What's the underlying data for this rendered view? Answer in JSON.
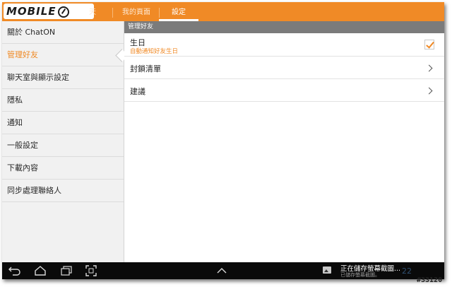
{
  "logo": {
    "text": "MOBILE",
    "name": "mobile01-logo"
  },
  "tabs": [
    {
      "label": "天",
      "active": false
    },
    {
      "label": "我的頁面",
      "active": false
    },
    {
      "label": "設定",
      "active": true
    }
  ],
  "sidebar": {
    "items": [
      {
        "label": "關於 ChatON",
        "active": false
      },
      {
        "label": "管理好友",
        "active": true
      },
      {
        "label": "聊天室與顯示設定",
        "active": false
      },
      {
        "label": "隱私",
        "active": false
      },
      {
        "label": "通知",
        "active": false
      },
      {
        "label": "一般設定",
        "active": false
      },
      {
        "label": "下載內容",
        "active": false
      },
      {
        "label": "同步處理聯絡人",
        "active": false
      }
    ]
  },
  "main": {
    "section_header": "管理好友",
    "rows": [
      {
        "title": "生日",
        "subtitle": "自動通知好友生日",
        "control": "checkbox",
        "checked": true
      },
      {
        "title": "封鎖清單",
        "control": "chevron-right-icon"
      },
      {
        "title": "建議",
        "control": "chevron-right-icon"
      }
    ]
  },
  "navbar": {
    "icons": [
      "back-icon",
      "home-icon",
      "recent-apps-icon",
      "screenshot-icon",
      "expand-up-icon"
    ],
    "notification": {
      "title": "正在儲存螢幕截圖...",
      "subtitle": "已儲存螢幕截圖。",
      "clock": "22"
    }
  },
  "watermark": "#33120",
  "colors": {
    "accent": "#f08a26",
    "section_header_bg": "#7b7b7b",
    "navbar_bg": "#0a0a0a",
    "sidebar_bg": "#f1f1f1"
  }
}
